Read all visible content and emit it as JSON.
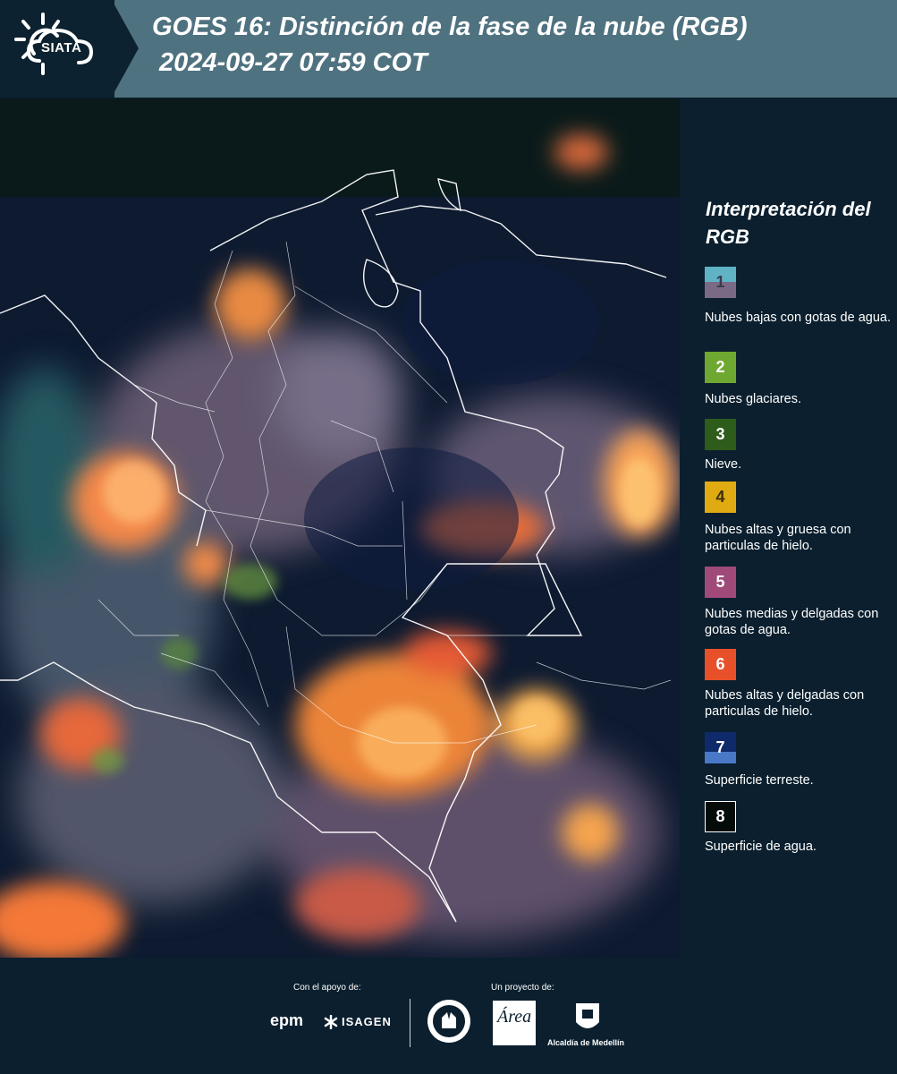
{
  "header": {
    "brand": "SIATA",
    "title": "GOES 16: Distinción de la fase de la nube (RGB)",
    "timestamp": "2024-09-27 07:59 COT"
  },
  "legend": {
    "title": "Interpretación del RGB",
    "items": [
      {
        "number": "1",
        "label": "Nubes bajas con gotas de agua.",
        "color_top": "#5fb3c4",
        "color_bottom": "#7a6a86"
      },
      {
        "number": "2",
        "label": "Nubes glaciares.",
        "color_top": "#6fa830",
        "color_bottom": "#6fa830"
      },
      {
        "number": "3",
        "label": "Nieve.",
        "color_top": "#2e5c1a",
        "color_bottom": "#2e5c1a"
      },
      {
        "number": "4",
        "label": "Nubes altas y gruesa con particulas de hielo.",
        "color_top": "#e0ab12",
        "color_bottom": "#e0ab12"
      },
      {
        "number": "5",
        "label": "Nubes medias y delgadas con gotas de agua.",
        "color_top": "#a04a7a",
        "color_bottom": "#a04a7a"
      },
      {
        "number": "6",
        "label": "Nubes altas y delgadas con particulas de hielo.",
        "color_top": "#e8502a",
        "color_bottom": "#e8502a"
      },
      {
        "number": "7",
        "label": "Superficie terreste.",
        "color_top": "#0e2a6b",
        "color_bottom": "#4a78c8"
      },
      {
        "number": "8",
        "label": "Superficie de agua.",
        "color_top": "#050b08",
        "color_bottom": "#050b08"
      }
    ]
  },
  "footer": {
    "support_label": "Con el apoyo de:",
    "project_label": "Un proyecto de:",
    "sponsor_1": "epm",
    "sponsor_2": "ISAGEN",
    "partner_2": "Área",
    "partner_3": "Alcaldía de Medellín"
  }
}
